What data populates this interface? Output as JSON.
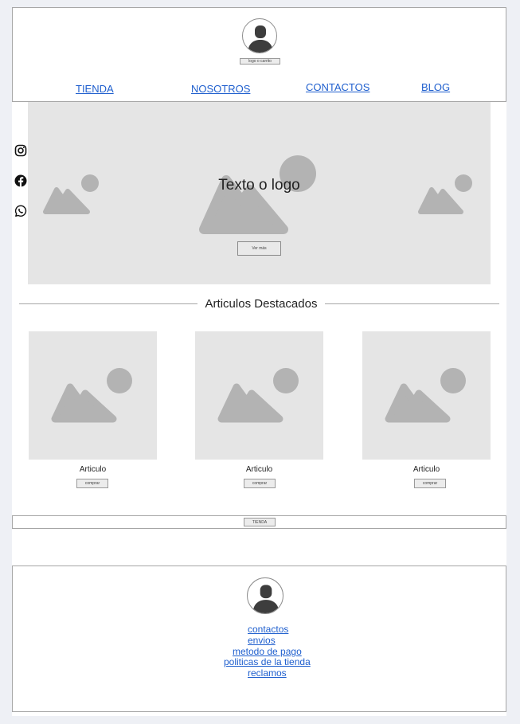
{
  "header": {
    "logo_button_label": "logo o carrito",
    "nav": [
      {
        "label": "TIENDA"
      },
      {
        "label": "NOSOTROS"
      },
      {
        "label": "CONTACTOS"
      },
      {
        "label": "BLOG"
      }
    ]
  },
  "hero": {
    "title": "Texto o logo",
    "button_label": "Ver más"
  },
  "social_icons": [
    "instagram-icon",
    "facebook-icon",
    "whatsapp-icon"
  ],
  "featured": {
    "title": "Articulos Destacados",
    "items": [
      {
        "name": "Articulo",
        "button_label": "comprar"
      },
      {
        "name": "Articulo",
        "button_label": "comprar"
      },
      {
        "name": "Articulo",
        "button_label": "comprar"
      }
    ]
  },
  "store_bar": {
    "button_label": "TIENDA"
  },
  "footer": {
    "links": [
      {
        "label": "contactos"
      },
      {
        "label": "envios"
      },
      {
        "label": "metodo de pago"
      },
      {
        "label": "politicas de la tienda"
      },
      {
        "label": "reclamos"
      }
    ]
  },
  "colors": {
    "page_bg": "#eef0f5",
    "placeholder_bg": "#e5e5e5",
    "placeholder_shape": "#b3b3b3",
    "link": "#1f5fce",
    "border": "#a6a6a6"
  }
}
